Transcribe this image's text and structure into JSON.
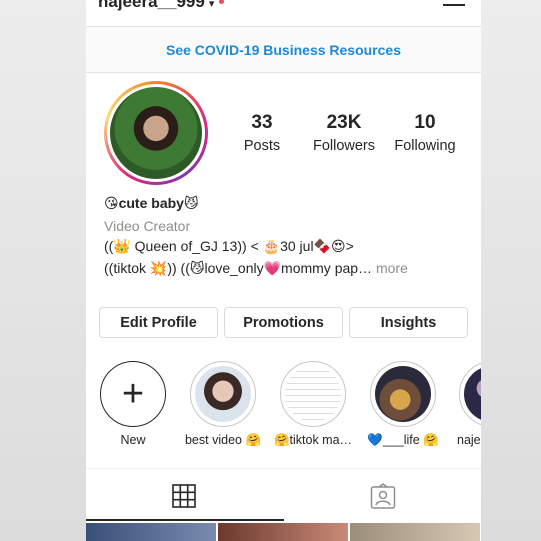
{
  "header": {
    "username": "najeera__999"
  },
  "banner": {
    "text": "See COVID-19 Business Resources"
  },
  "stats": [
    {
      "value": "33",
      "label": "Posts"
    },
    {
      "value": "23K",
      "label": "Followers"
    },
    {
      "value": "10",
      "label": "Following"
    }
  ],
  "bio": {
    "name": "😘cute baby😼",
    "category": "Video Creator",
    "line1": "((👑 Queen of_GJ 13)) < 🎂30 jul🍫😍>",
    "line2": "((tiktok 💥)) ((😼love_only💗mommy pap…",
    "more": "more"
  },
  "buttons": {
    "edit": "Edit Profile",
    "promotions": "Promotions",
    "insights": "Insights"
  },
  "highlights": [
    {
      "label": "New"
    },
    {
      "label": "best video 🤗"
    },
    {
      "label": "🤗tiktok ma…"
    },
    {
      "label": "💙___life 🤗"
    },
    {
      "label": "naje"
    }
  ]
}
